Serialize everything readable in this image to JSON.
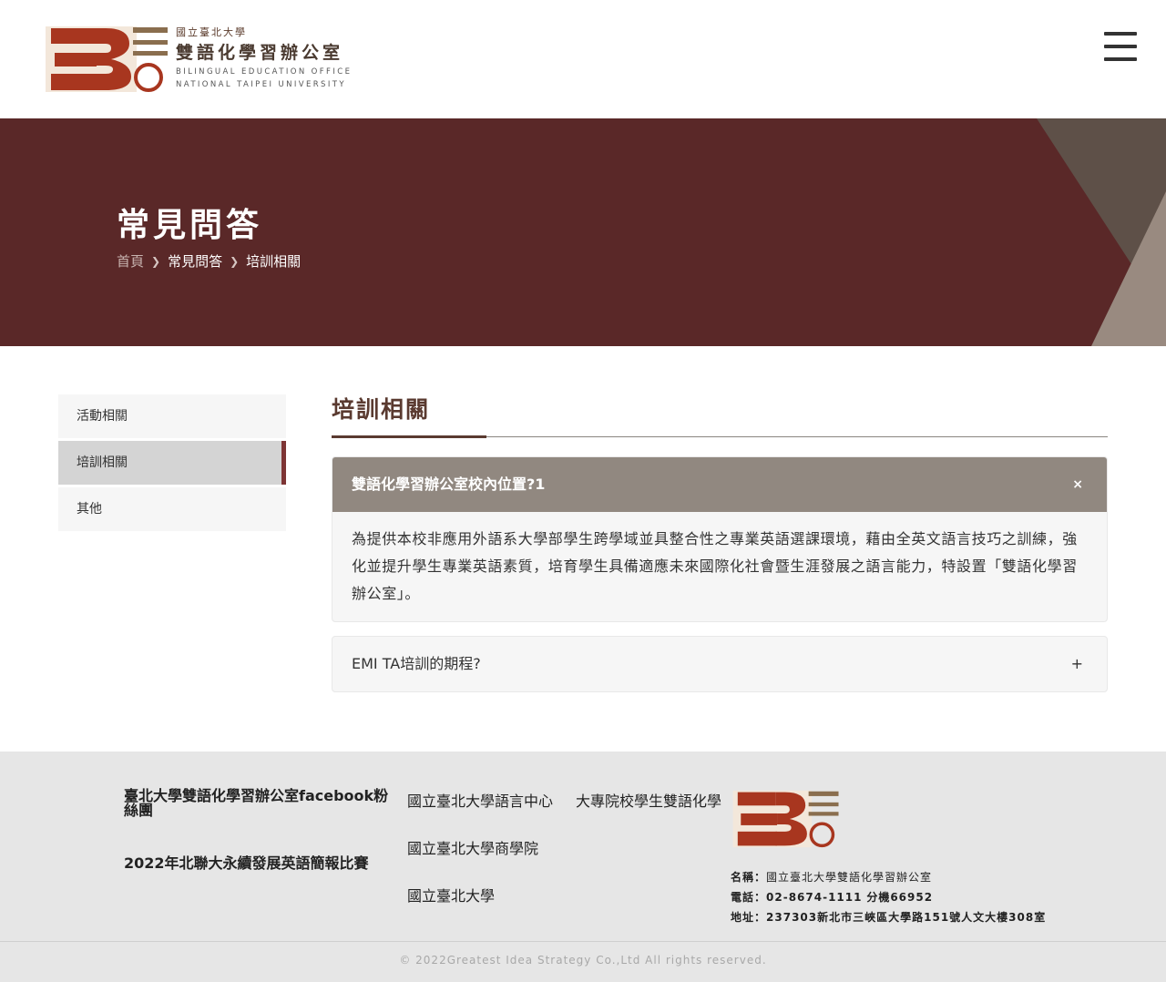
{
  "header": {
    "logo": {
      "line1": "國立臺北大學",
      "line2": "雙語化學習辦公室",
      "line3": "BILINGUAL EDUCATION OFFICE",
      "line4": "NATIONAL TAIPEI UNIVERSITY"
    },
    "menu_icon": "hamburger-icon"
  },
  "hero": {
    "title": "常見問答",
    "breadcrumb": [
      "首頁",
      "常見問答",
      "培訓相關"
    ]
  },
  "sidebar": {
    "items": [
      {
        "label": "活動相關",
        "active": false
      },
      {
        "label": "培訓相關",
        "active": true
      },
      {
        "label": "其他",
        "active": false
      }
    ]
  },
  "main": {
    "title": "培訓相關",
    "faqs": [
      {
        "question": "雙語化學習辦公室校內位置?1",
        "answer": "為提供本校非應用外語系大學部學生跨學域並具整合性之專業英語選課環境，藉由全英文語言技巧之訓練，強化並提升學生專業英語素質，培育學生具備適應未來國際化社會暨生涯發展之語言能力，特設置「雙語化學習辦公室」。",
        "toggle": "×",
        "expanded": true
      },
      {
        "question": "EMI TA培訓的期程?",
        "toggle": "+",
        "expanded": false
      }
    ]
  },
  "footer": {
    "links": {
      "facebook": "臺北大學雙語化學習辦公室facebook粉絲團",
      "contest": "2022年北聯大永續發展英語簡報比賽",
      "lang_center": "國立臺北大學語言中心",
      "business": "國立臺北大學商學院",
      "ntpu": "國立臺北大學",
      "cross_school": "大專院校學生雙語化學"
    },
    "info": {
      "name_label": "名稱：",
      "name": "國立臺北大學雙語化學習辦公室",
      "tel_label": "電話：",
      "tel": "02-8674-1111",
      "ext": "分機66952",
      "addr_label": "地址：",
      "addr": "237303新北市三峽區大學路151號人文大樓308室"
    },
    "copyright": "© 2022Greatest Idea Strategy Co.,Ltd All rights reserved."
  },
  "colors": {
    "brand_red": "#a8361f",
    "brand_brown": "#8a6e4e",
    "hero_bg": "#5a2828",
    "faq_active_bg": "#918880",
    "sidebar_accent": "#7d3434"
  }
}
